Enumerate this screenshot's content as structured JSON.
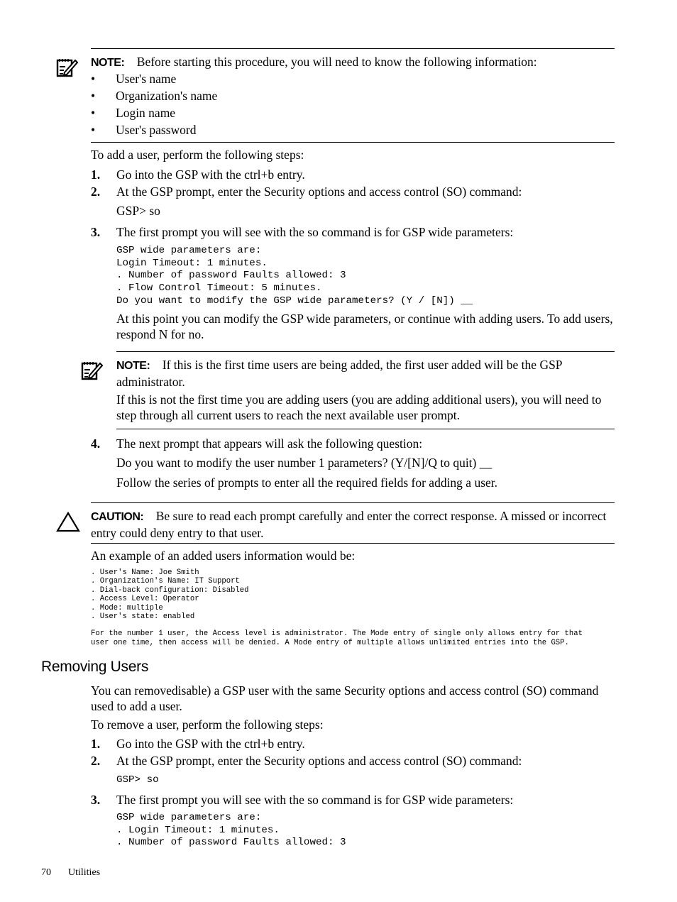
{
  "note1": {
    "label": "NOTE:",
    "text": "Before starting this procedure, you will need to know the following information:",
    "bullets": [
      "User's name",
      "Organization's name",
      "Login name",
      "User's password"
    ],
    "bullet_glyph": "•",
    "icon": "note-pencil-icon"
  },
  "add_intro": "To add a user, perform the following steps:",
  "add_steps": [
    {
      "num": "1.",
      "text": "Go into the GSP with the ctrl+b entry."
    },
    {
      "num": "2.",
      "text": "At the GSP prompt, enter the Security options and access control (SO) command:",
      "sub": "GSP> so"
    },
    {
      "num": "3.",
      "text": "The first prompt you will see with the so command is for GSP wide parameters:",
      "code": [
        "GSP wide parameters are:",
        "Login Timeout: 1 minutes.",
        ". Number of password Faults allowed: 3",
        ". Flow Control Timeout: 5 minutes.",
        "Do you want to modify the GSP wide parameters? (Y / [N]) __"
      ],
      "after": "At this point you can modify the GSP wide parameters, or continue with adding users. To add users, respond N for no."
    },
    {
      "num": "4.",
      "text": "The next prompt that appears will ask the following question:",
      "sub1": "Do you want to modify the user number 1 parameters? (Y/[N]/Q to quit) __",
      "sub2": "Follow the series of prompts to enter all the required fields for adding a user."
    }
  ],
  "note2": {
    "label": "NOTE:",
    "text": "If this is the first time users are being added, the first user added will be the GSP administrator.",
    "para2": "If this is not the first time you are adding users (you are adding additional users), you will need to step through all current users to reach the next available user prompt.",
    "icon": "note-pencil-icon"
  },
  "caution": {
    "label": "CAUTION:",
    "text": "Be sure to read each prompt carefully and enter the correct response. A missed or incorrect entry could deny entry to that user.",
    "icon": "caution-triangle-icon"
  },
  "example_intro": "An example of an added users information would be:",
  "example_code": [
    ". User's Name: Joe Smith",
    ". Organization's Name: IT Support",
    ". Dial-back configuration: Disabled",
    ". Access Level: Operator",
    ". Mode: multiple",
    ". User's state: enabled"
  ],
  "example_note": [
    "For the number 1 user, the Access level is administrator. The Mode entry of single only allows entry for that",
    "user one time, then access will be denied. A Mode entry of multiple allows unlimited entries into the GSP."
  ],
  "removing": {
    "heading": "Removing Users",
    "para": "You can removedisable) a GSP user with the same Security options and access control (SO) command used to add a user.",
    "intro": "To remove a user, perform the following steps:",
    "steps": [
      {
        "num": "1.",
        "text": "Go into the GSP with the ctrl+b entry."
      },
      {
        "num": "2.",
        "text": "At the GSP prompt, enter the Security options and access control (SO) command:",
        "code": "GSP> so"
      },
      {
        "num": "3.",
        "text": "The first prompt you will see with the so command is for GSP wide parameters:",
        "code": [
          "GSP wide parameters are:",
          ". Login Timeout: 1 minutes.",
          ". Number of password Faults allowed: 3"
        ]
      }
    ]
  },
  "footer": {
    "page": "70",
    "section": "Utilities"
  }
}
